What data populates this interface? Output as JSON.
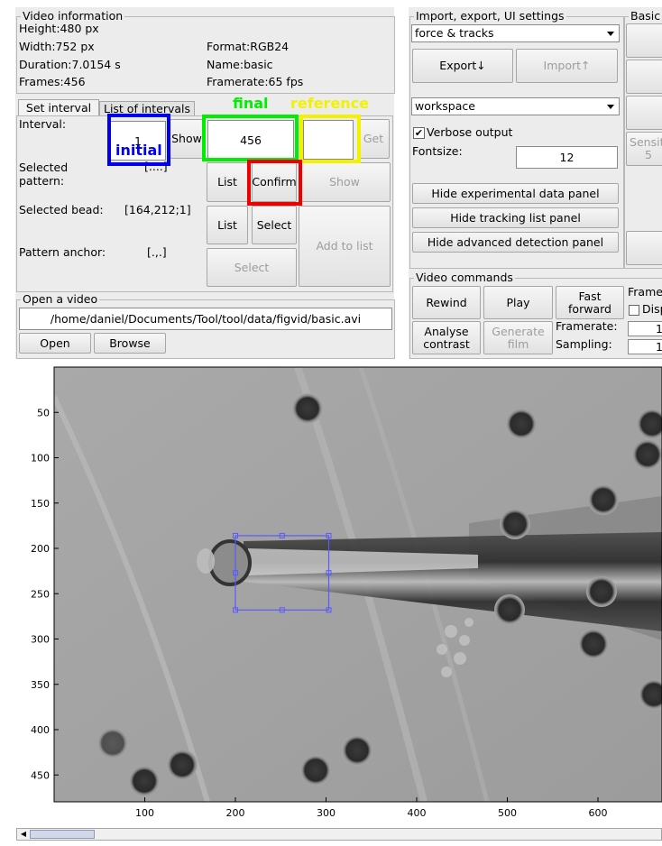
{
  "video_info": {
    "title": "Video information",
    "height": "Height:480 px",
    "width": "Width:752 px",
    "duration": "Duration:7.0154 s",
    "frames": "Frames:456",
    "format": "Format:RGB24",
    "name": "Name:basic",
    "framerate": "Framerate:65 fps"
  },
  "tabs": [
    "Set interval",
    "List of intervals"
  ],
  "interval": {
    "label": "Interval:",
    "initial_value": "1",
    "show_label": "Show",
    "final_value": "456",
    "reference_value": "",
    "get_label": "Get"
  },
  "selected_pattern": {
    "label": "Selected\npattern:",
    "value": "[....]",
    "list_label": "List",
    "confirm_label": "Confirm",
    "show_label": "Show"
  },
  "selected_bead": {
    "label": "Selected bead:",
    "value": "[164,212;1]",
    "list_label": "List",
    "select_label": "Select"
  },
  "pattern_anchor": {
    "label": "Pattern anchor:",
    "value": "[.,.]",
    "select_label": "Select",
    "add_label": "Add to list"
  },
  "annotations": {
    "initial": "initial",
    "final": "final",
    "reference": "reference"
  },
  "open_video": {
    "title": "Open a video",
    "path": "/home/daniel/Documents/Tool/tool/data/figvid/basic.avi",
    "open_label": "Open",
    "browse_label": "Browse"
  },
  "import_export": {
    "title": "Import, export, UI settings",
    "select_value": "force & tracks",
    "export_label": "Export↓",
    "import_label": "Import↑",
    "workspace_value": "workspace",
    "verbose_label": "Verbose output",
    "verbose_checked": true,
    "fontsize_label": "Fontsize:",
    "fontsize_value": "12",
    "hide_exp": "Hide experimental data panel",
    "hide_tracking": "Hide tracking list panel",
    "hide_adv": "Hide advanced detection panel"
  },
  "basic": {
    "title": "Basic",
    "sensitivity_label": "Sensiti",
    "sensitivity_value": "5"
  },
  "video_commands": {
    "title": "Video commands",
    "rewind": "Rewind",
    "play": "Play",
    "fast_forward": "Fast\nforward",
    "analyse": "Analyse\ncontrast",
    "generate": "Generate\nfilm",
    "framerate_label": "Framerate:",
    "sampling_label": "Sampling:",
    "frame_label": "Frame",
    "disp_label": "Disp",
    "framerate_value": "1",
    "sampling_value": "1"
  },
  "chart_data": {
    "type": "image",
    "x_ticks": [
      "100",
      "200",
      "300",
      "400",
      "500",
      "600"
    ],
    "y_ticks": [
      "50",
      "100",
      "150",
      "200",
      "250",
      "300",
      "350",
      "400",
      "450"
    ],
    "roi": {
      "x": [
        200,
        303
      ],
      "y": [
        186,
        268
      ]
    }
  },
  "colors": {
    "initial": "#0000ee",
    "final": "#00ee00",
    "reference": "#f2f200",
    "confirm": "#ee0000",
    "roi": "#5a5aff"
  }
}
